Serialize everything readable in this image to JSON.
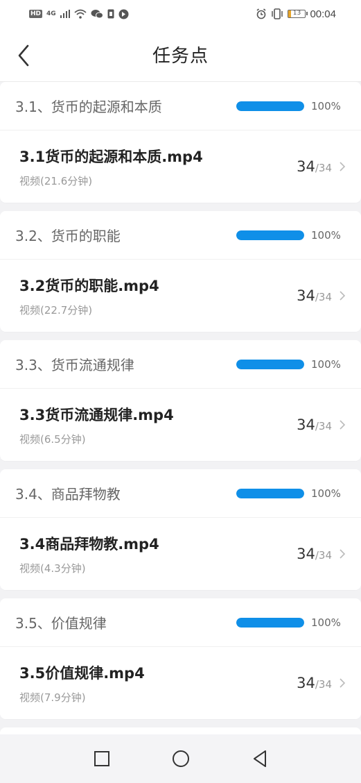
{
  "status_bar": {
    "hd": "HD",
    "network": "4G",
    "battery_level": "13",
    "time": "00:04",
    "icons": [
      "hd-icon",
      "signal-icon",
      "wifi-icon",
      "wechat-icon",
      "sim-icon",
      "shield-icon",
      "alarm-icon",
      "vibrate-icon",
      "battery-icon"
    ]
  },
  "header": {
    "title": "任务点"
  },
  "colors": {
    "accent": "#0f8fe8",
    "title_text": "#222222",
    "secondary_text": "#999999"
  },
  "sections": [
    {
      "title": "3.1、货币的起源和本质",
      "progress": 1.0,
      "progress_label": "100%",
      "items": [
        {
          "title": "3.1货币的起源和本质.mp4",
          "subtitle": "视频(21.6分钟)",
          "done": "34",
          "sep": "/",
          "total": "34"
        }
      ]
    },
    {
      "title": "3.2、货币的职能",
      "progress": 1.0,
      "progress_label": "100%",
      "items": [
        {
          "title": "3.2货币的职能.mp4",
          "subtitle": "视频(22.7分钟)",
          "done": "34",
          "sep": "/",
          "total": "34"
        }
      ]
    },
    {
      "title": "3.3、货币流通规律",
      "progress": 1.0,
      "progress_label": "100%",
      "items": [
        {
          "title": "3.3货币流通规律.mp4",
          "subtitle": "视频(6.5分钟)",
          "done": "34",
          "sep": "/",
          "total": "34"
        }
      ]
    },
    {
      "title": "3.4、商品拜物教",
      "progress": 1.0,
      "progress_label": "100%",
      "items": [
        {
          "title": "3.4商品拜物教.mp4",
          "subtitle": "视频(4.3分钟)",
          "done": "34",
          "sep": "/",
          "total": "34"
        }
      ]
    },
    {
      "title": "3.5、价值规律",
      "progress": 1.0,
      "progress_label": "100%",
      "items": [
        {
          "title": "3.5价值规律.mp4",
          "subtitle": "视频(7.9分钟)",
          "done": "34",
          "sep": "/",
          "total": "34"
        }
      ]
    }
  ],
  "nav_bar": {
    "buttons": [
      "recent-apps",
      "home",
      "back"
    ]
  }
}
